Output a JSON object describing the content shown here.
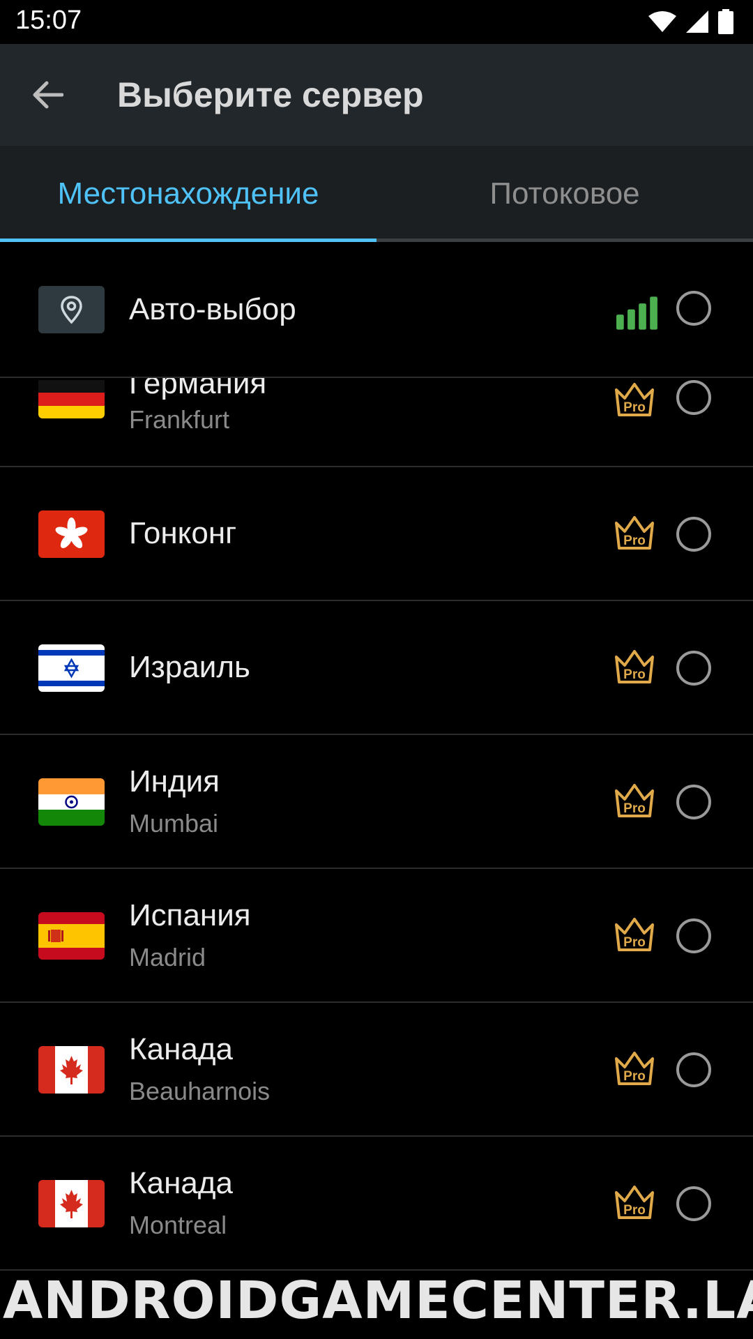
{
  "status_bar": {
    "time": "15:07",
    "icons": [
      "wifi-icon",
      "signal-icon",
      "battery-icon"
    ]
  },
  "app_bar": {
    "back_icon": "arrow-back-icon",
    "title": "Выберите сервер"
  },
  "tabs": [
    {
      "label": "Местонахождение",
      "selected": true
    },
    {
      "label": "Потоковое",
      "selected": false
    }
  ],
  "colors": {
    "accent": "#4fc3f7",
    "pro_gold": "#e0a94a",
    "signal_green": "#4caf50"
  },
  "servers": [
    {
      "country": "Авто-выбор",
      "city": "",
      "icon": "location-pin-icon",
      "badge": "signal-strength-icon"
    },
    {
      "country": "Германия",
      "city": "Frankfurt",
      "icon": "flag-germany-icon",
      "badge": "pro-crown-icon"
    },
    {
      "country": "Гонконг",
      "city": "",
      "icon": "flag-hong-kong-icon",
      "badge": "pro-crown-icon"
    },
    {
      "country": "Израиль",
      "city": "",
      "icon": "flag-israel-icon",
      "badge": "pro-crown-icon"
    },
    {
      "country": "Индия",
      "city": "Mumbai",
      "icon": "flag-india-icon",
      "badge": "pro-crown-icon"
    },
    {
      "country": "Испания",
      "city": "Madrid",
      "icon": "flag-spain-icon",
      "badge": "pro-crown-icon"
    },
    {
      "country": "Канада",
      "city": "Beauharnois",
      "icon": "flag-canada-icon",
      "badge": "pro-crown-icon"
    },
    {
      "country": "Канада",
      "city": "Montreal",
      "icon": "flag-canada-icon",
      "badge": "pro-crown-icon"
    }
  ],
  "pro_label": "Pro",
  "watermark": "ANDROIDGAMECENTER.LAT"
}
